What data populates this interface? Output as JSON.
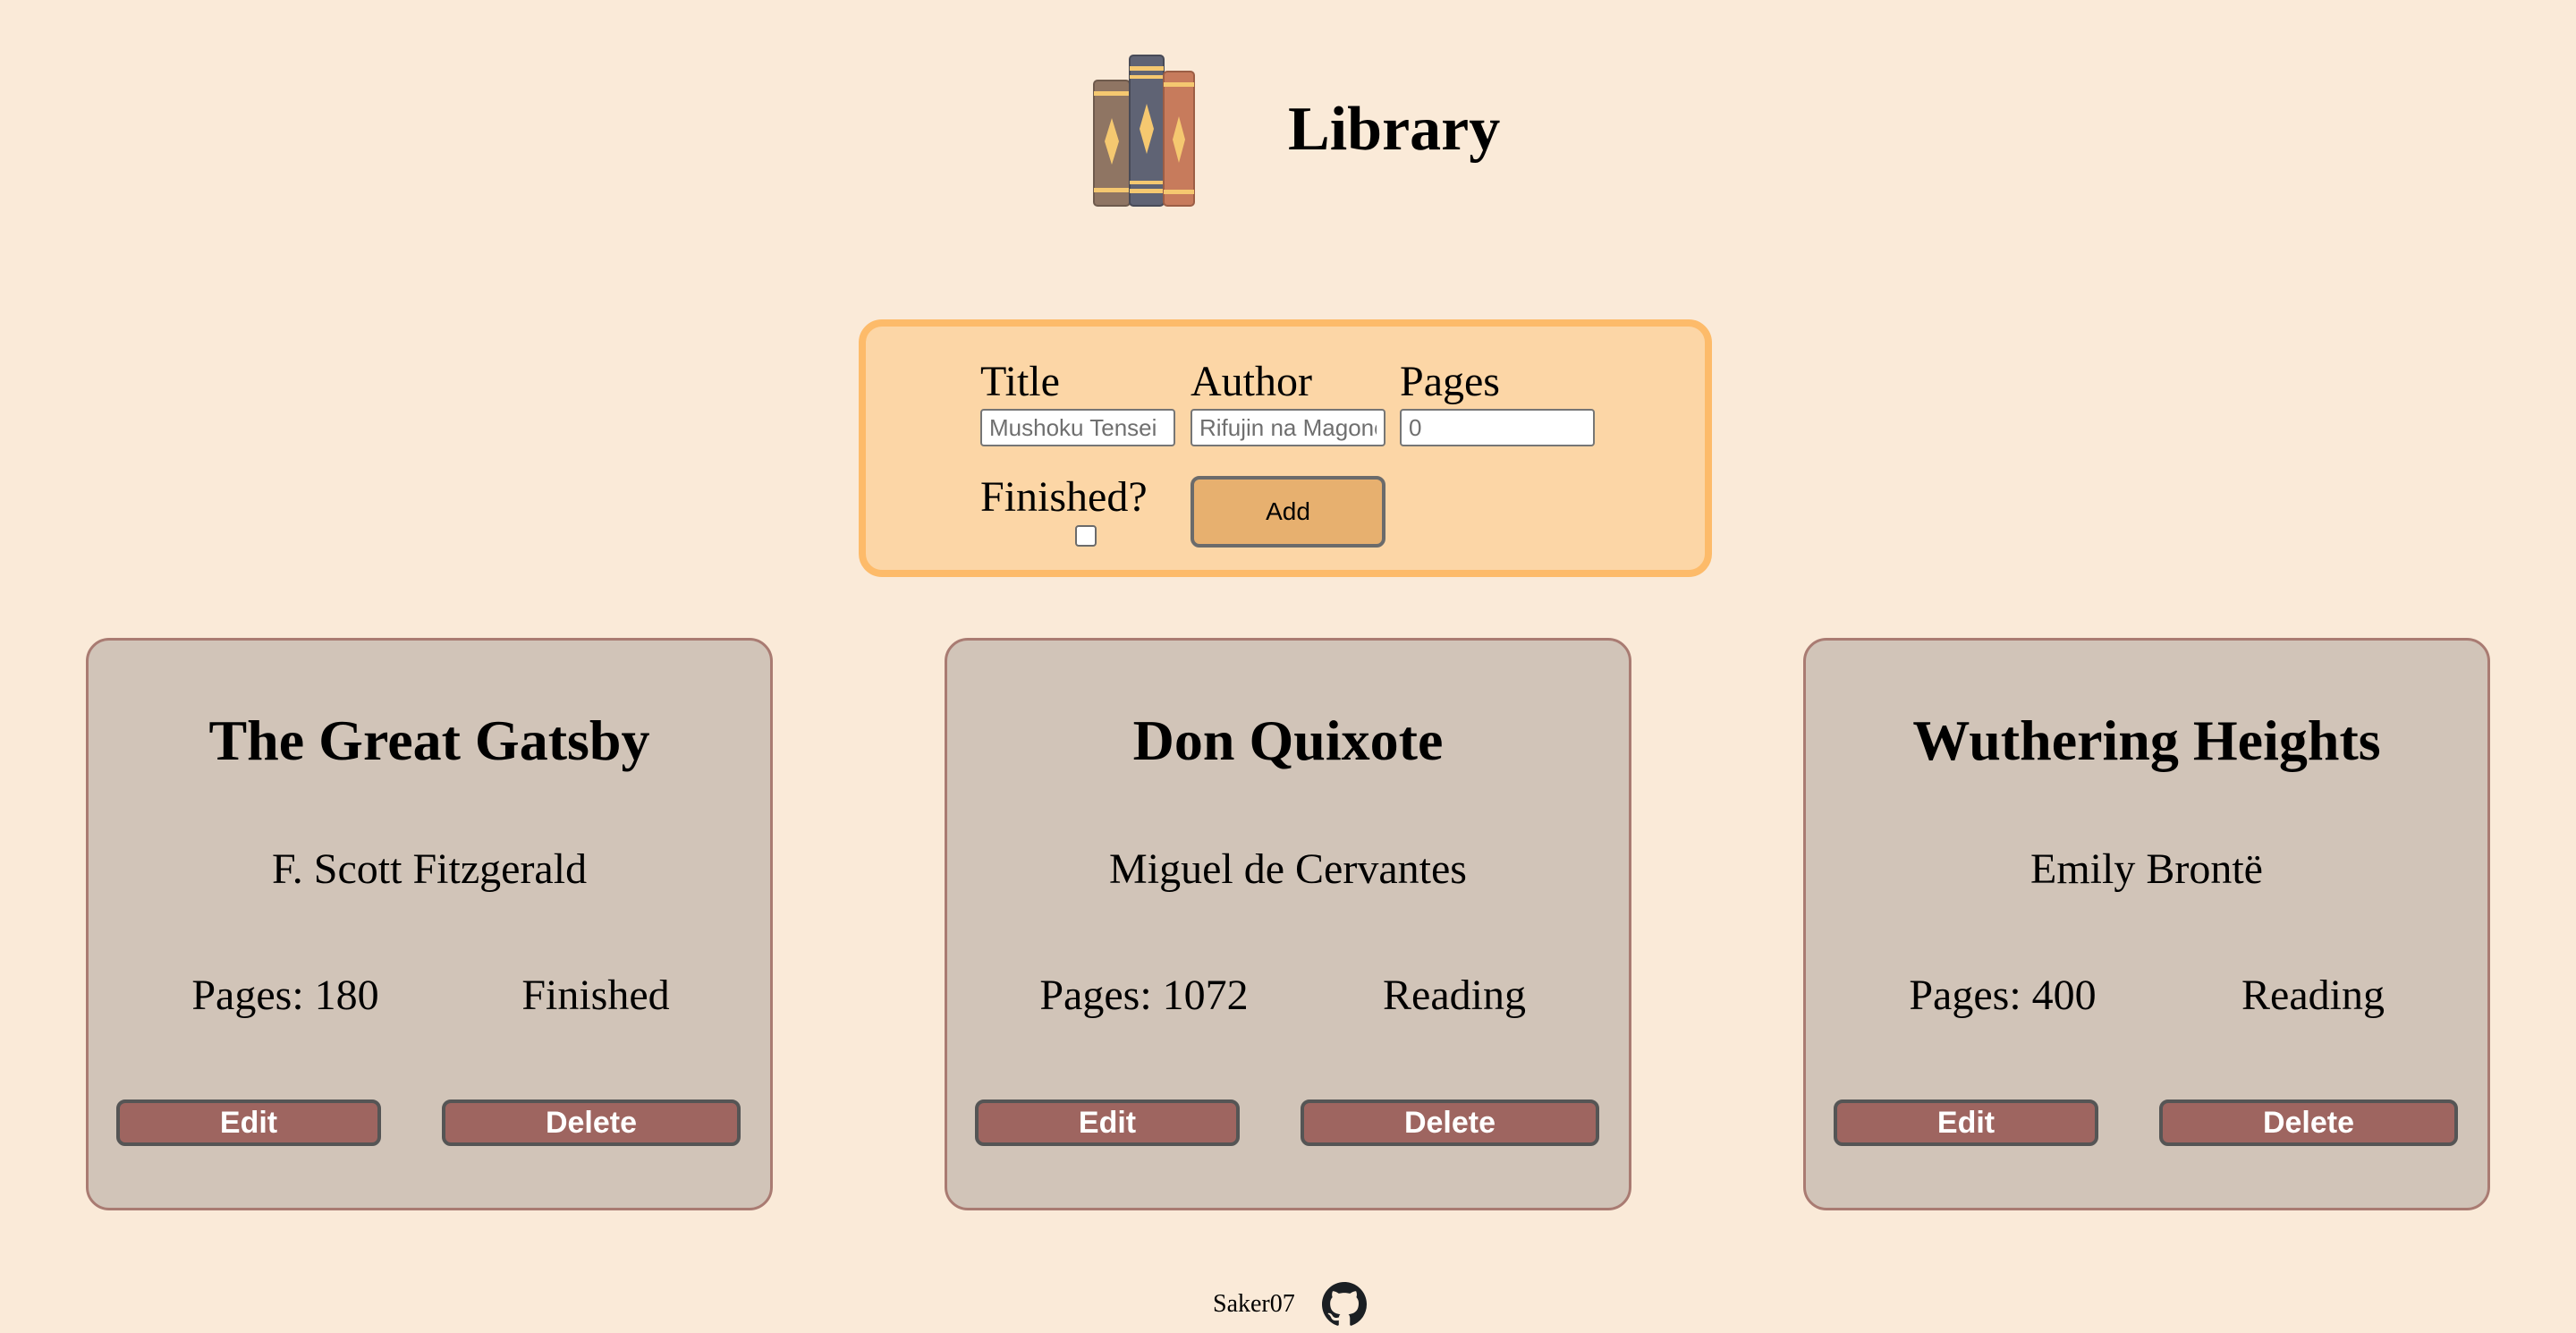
{
  "header": {
    "title": "Library",
    "logo_icon": "books-icon"
  },
  "form": {
    "title_label": "Title",
    "title_placeholder": "Mushoku Tensei",
    "author_label": "Author",
    "author_placeholder": "Rifujin na Magonote",
    "pages_label": "Pages",
    "pages_placeholder": "0",
    "finished_label": "Finished?",
    "finished_checked": false,
    "add_label": "Add"
  },
  "books": [
    {
      "title": "The Great Gatsby",
      "author": "F. Scott Fitzgerald",
      "pages": "Pages: 180",
      "status": "Finished",
      "edit_label": "Edit",
      "delete_label": "Delete"
    },
    {
      "title": "Don Quixote",
      "author": "Miguel de Cervantes",
      "pages": "Pages: 1072",
      "status": "Reading",
      "edit_label": "Edit",
      "delete_label": "Delete"
    },
    {
      "title": "Wuthering Heights",
      "author": "Emily Brontë",
      "pages": "Pages: 400",
      "status": "Reading",
      "edit_label": "Edit",
      "delete_label": "Delete"
    }
  ],
  "footer": {
    "author": "Saker07",
    "link_icon": "github-icon"
  },
  "colors": {
    "background": "#faead8",
    "form_bg": "#fcd6a6",
    "form_border": "#fdbb6a",
    "card_bg": "#d1c4b8",
    "card_border": "#a97b72",
    "button_bg": "#9e6560",
    "add_button_bg": "#e7b06f"
  }
}
